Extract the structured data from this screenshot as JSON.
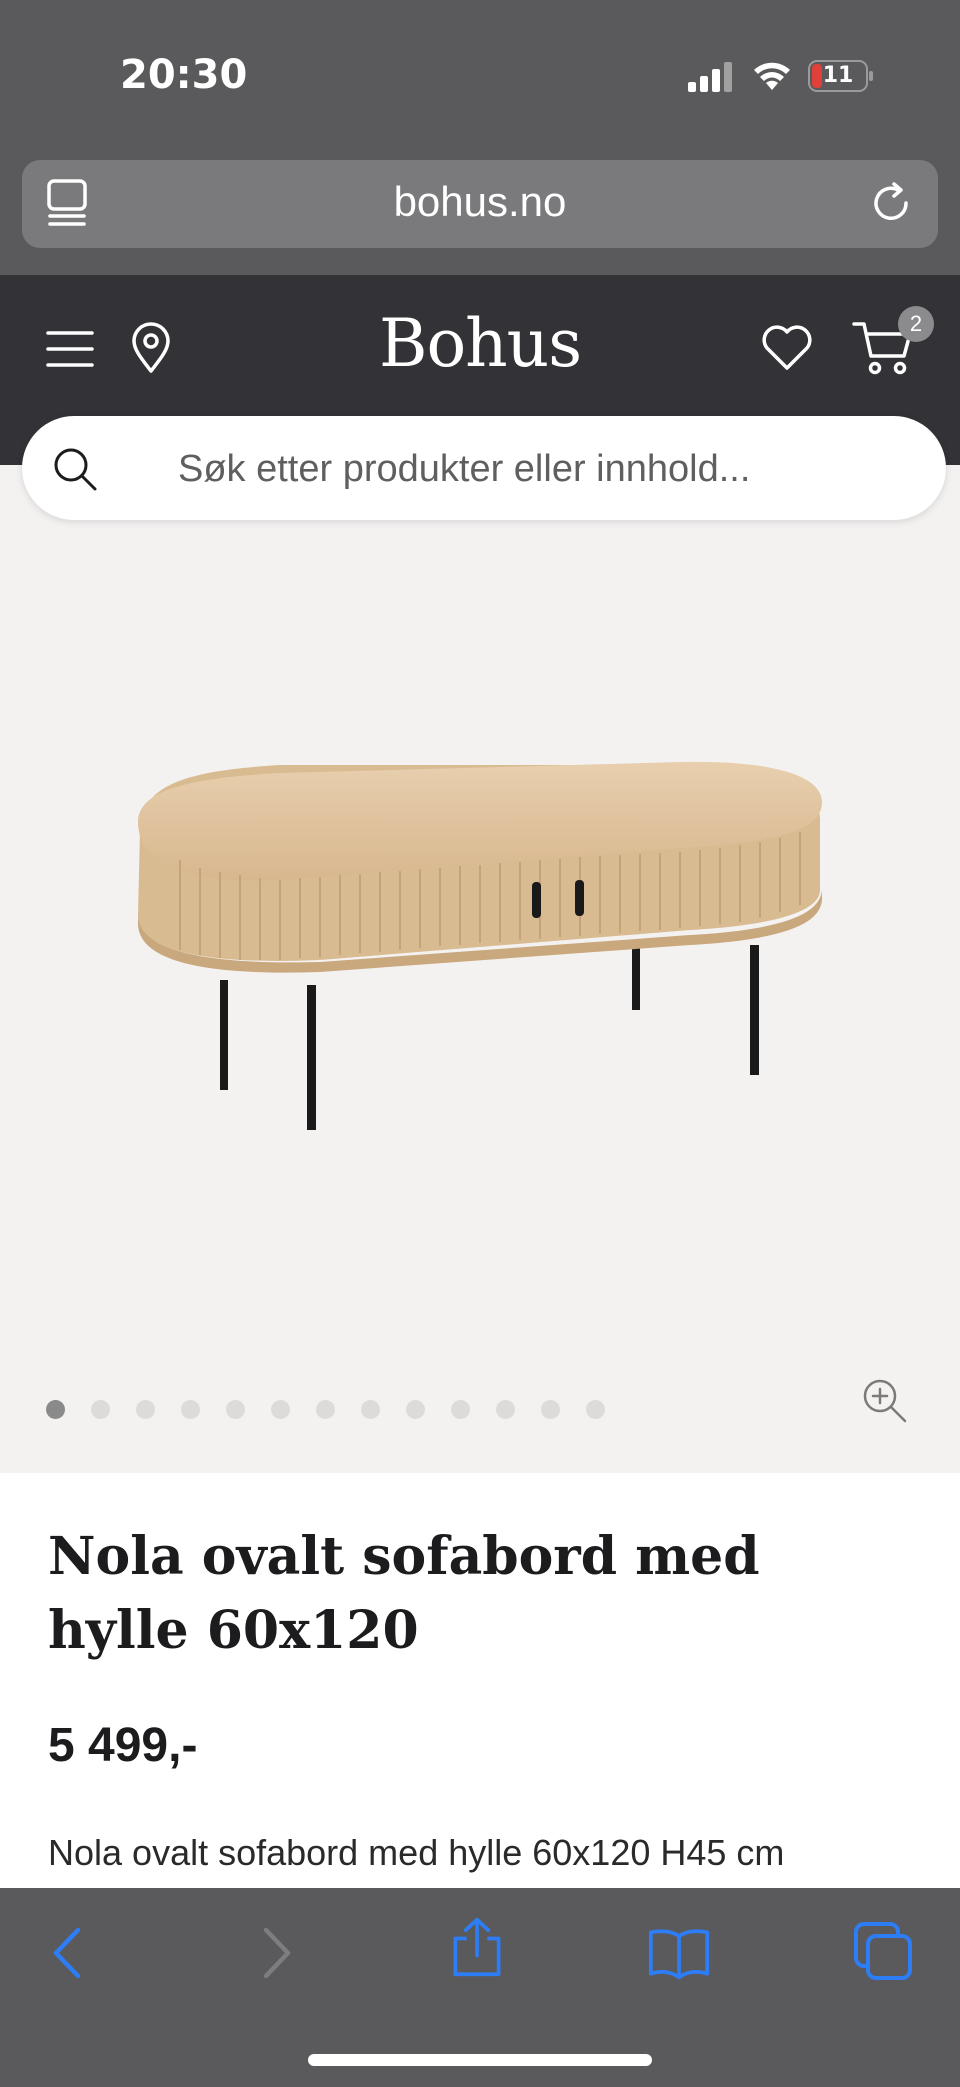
{
  "status": {
    "time": "20:30",
    "battery": "11"
  },
  "browser": {
    "url": "bohus.no"
  },
  "header": {
    "logo": "Bohus",
    "cart_count": "2"
  },
  "search": {
    "placeholder": "Søk etter produkter eller innhold..."
  },
  "gallery": {
    "total_images": 13,
    "active_index": 0
  },
  "product": {
    "title": "Nola ovalt sofabord med hylle 60x120",
    "price": "5 499,-",
    "description": "Nola ovalt sofabord med hylle 60x120 H45 cm"
  },
  "colors": {
    "header_bg": "#333236",
    "chrome_bg": "#5a5a5c",
    "gallery_bg": "#f4f2f1",
    "accent_blue": "#2d7df6",
    "battery_red": "#e0403a"
  },
  "icons": [
    "tabs-icon",
    "reload-icon",
    "menu-icon",
    "location-icon",
    "heart-icon",
    "cart-icon",
    "search-icon",
    "zoom-in-icon",
    "back-icon",
    "forward-icon",
    "share-icon",
    "bookmarks-icon",
    "tabs-overview-icon"
  ]
}
